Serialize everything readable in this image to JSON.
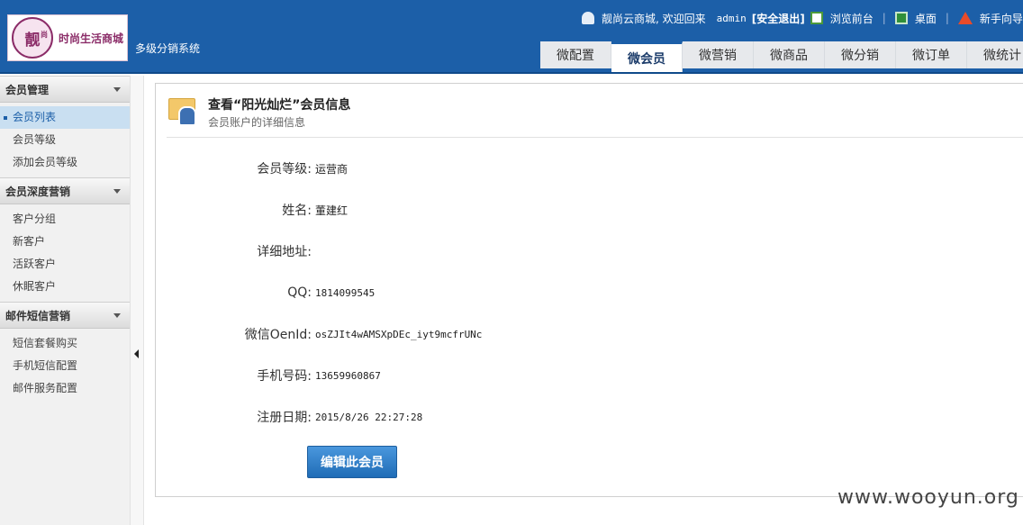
{
  "header": {
    "logo_text": "时尚生活商城",
    "logo_badge": "靓",
    "logo_badge_small": "尚",
    "subtitle": "多级分销系统",
    "welcome": "靓尚云商城, 欢迎回来",
    "username": "admin",
    "logout": "[安全退出]",
    "front": "浏览前台",
    "desktop": "桌面",
    "newbie": "新手向导",
    "tabs": [
      "微配置",
      "微会员",
      "微营销",
      "微商品",
      "微分销",
      "微订单",
      "微统计"
    ],
    "active_tab": "微会员"
  },
  "sidebar": {
    "groups": [
      {
        "title": "会员管理",
        "items": [
          "会员列表",
          "会员等级",
          "添加会员等级"
        ]
      },
      {
        "title": "会员深度营销",
        "items": [
          "客户分组",
          "新客户",
          "活跃客户",
          "休眠客户"
        ]
      },
      {
        "title": "邮件短信营销",
        "items": [
          "短信套餐购买",
          "手机短信配置",
          "邮件服务配置"
        ]
      }
    ],
    "active_item": "会员列表"
  },
  "main": {
    "title": "查看“阳光灿烂”会员信息",
    "subtitle": "会员账户的详细信息",
    "fields": [
      {
        "label": "会员等级:",
        "value": "运营商"
      },
      {
        "label": "姓名:",
        "value": "董建红"
      },
      {
        "label": "详细地址:",
        "value": ""
      },
      {
        "label": "QQ:",
        "value": "1814099545"
      },
      {
        "label": "微信OenId:",
        "value": "osZJIt4wAMSXpDEc_iyt9mcfrUNc"
      },
      {
        "label": "手机号码:",
        "value": "13659960867"
      },
      {
        "label": "注册日期:",
        "value": "2015/8/26 22:27:28"
      }
    ],
    "edit_button": "编辑此会员"
  },
  "watermark": "www.wooyun.org",
  "colors": {
    "header_bg": "#1c5fa8",
    "brand": "#8b2c68",
    "button": "#1f6cb6",
    "active_item_bg": "#c9dff1"
  },
  "icons": {
    "user": "user-icon",
    "front": "browser-icon",
    "desktop": "monitor-icon",
    "newbie": "flag-icon",
    "folder": "folder-user-icon",
    "collapse": "collapse-left-icon",
    "group_arrow": "chevron-down-icon"
  }
}
